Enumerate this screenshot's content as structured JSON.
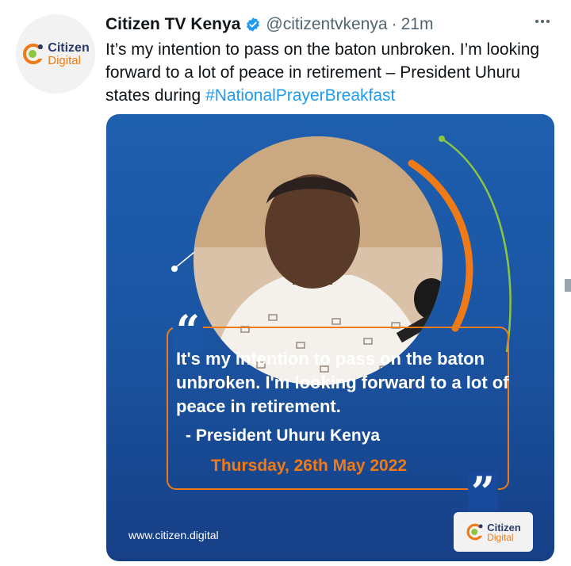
{
  "account": {
    "avatar_line1": "Citizen",
    "avatar_line2": "Digital",
    "display_name": "Citizen TV Kenya",
    "verified": true,
    "handle": "@citizentvkenya",
    "separator": "·",
    "time_ago": "21m"
  },
  "tweet": {
    "text_before": "It’s my intention to pass on the baton unbroken. I’m looking forward to a lot of peace in retirement – President Uhuru states during ",
    "hashtag": "#NationalPrayerBreakfast"
  },
  "media": {
    "quote_open": "“",
    "quote_close": "”",
    "quote_text": "It's my intention to pass on the baton unbroken. I'm looking forward to a lot of peace in retirement.",
    "attribution": "- President Uhuru Kenya",
    "date": "Thursday, 26th May 2022",
    "site_url": "www.citizen.digital",
    "logo_line1": "Citizen",
    "logo_line2": "Digital"
  },
  "colors": {
    "accent_orange": "#f07a16",
    "card_blue": "#1b56a4",
    "link_blue": "#1d9bf0",
    "verified_blue": "#1d9bf0",
    "deco_green": "#8cc63f"
  },
  "icons": {
    "verified": "verified-badge-icon",
    "more": "more-options-icon",
    "logo": "citizen-digital-logo"
  }
}
